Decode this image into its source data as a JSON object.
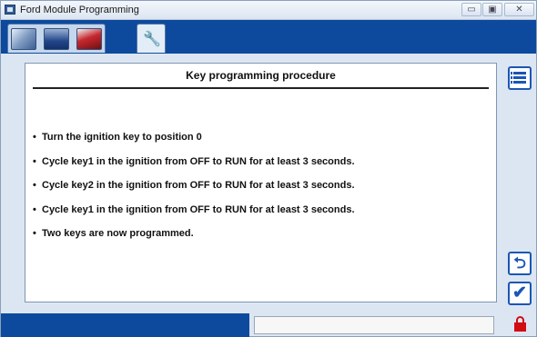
{
  "window": {
    "title": "Ford Module Programming",
    "min_glyph": "▭",
    "max_glyph": "▣",
    "close_glyph": "✕"
  },
  "tabs": [
    {
      "icon": "module-icon",
      "active": false
    },
    {
      "icon": "vehicle-icon",
      "active": false
    },
    {
      "icon": "tool-kit-icon",
      "active": false
    },
    {
      "icon": "wrench-icon",
      "active": true
    }
  ],
  "tab_glyph": "🔧",
  "panel": {
    "title": "Key programming procedure",
    "steps": [
      "Turn the ignition key to position 0",
      "Cycle key1 in the ignition from OFF to RUN for at least 3 seconds.",
      "Cycle key2 in the ignition from OFF to RUN for at least 3 seconds.",
      "Cycle key1 in the ignition from OFF to RUN for at least 3 seconds.",
      "Two keys are now programmed."
    ]
  },
  "side": {
    "back_glyph": "⮌",
    "ok_glyph": "✔"
  },
  "colors": {
    "band": "#0d4a9e",
    "accent": "#1a57b5",
    "lock": "#d10c12"
  }
}
